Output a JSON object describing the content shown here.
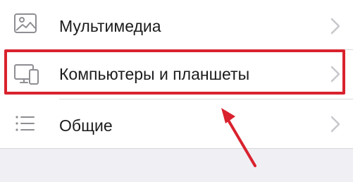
{
  "settings_list": {
    "items": [
      {
        "label": "Мультимедиа",
        "icon": "photo-icon"
      },
      {
        "label": "Компьютеры и планшеты",
        "icon": "devices-icon"
      },
      {
        "label": "Общие",
        "icon": "list-icon"
      }
    ]
  },
  "colors": {
    "highlight": "#d9222e",
    "background": "#efeff4",
    "chevron": "#c7c7cc",
    "icon": "#8e8e93"
  }
}
